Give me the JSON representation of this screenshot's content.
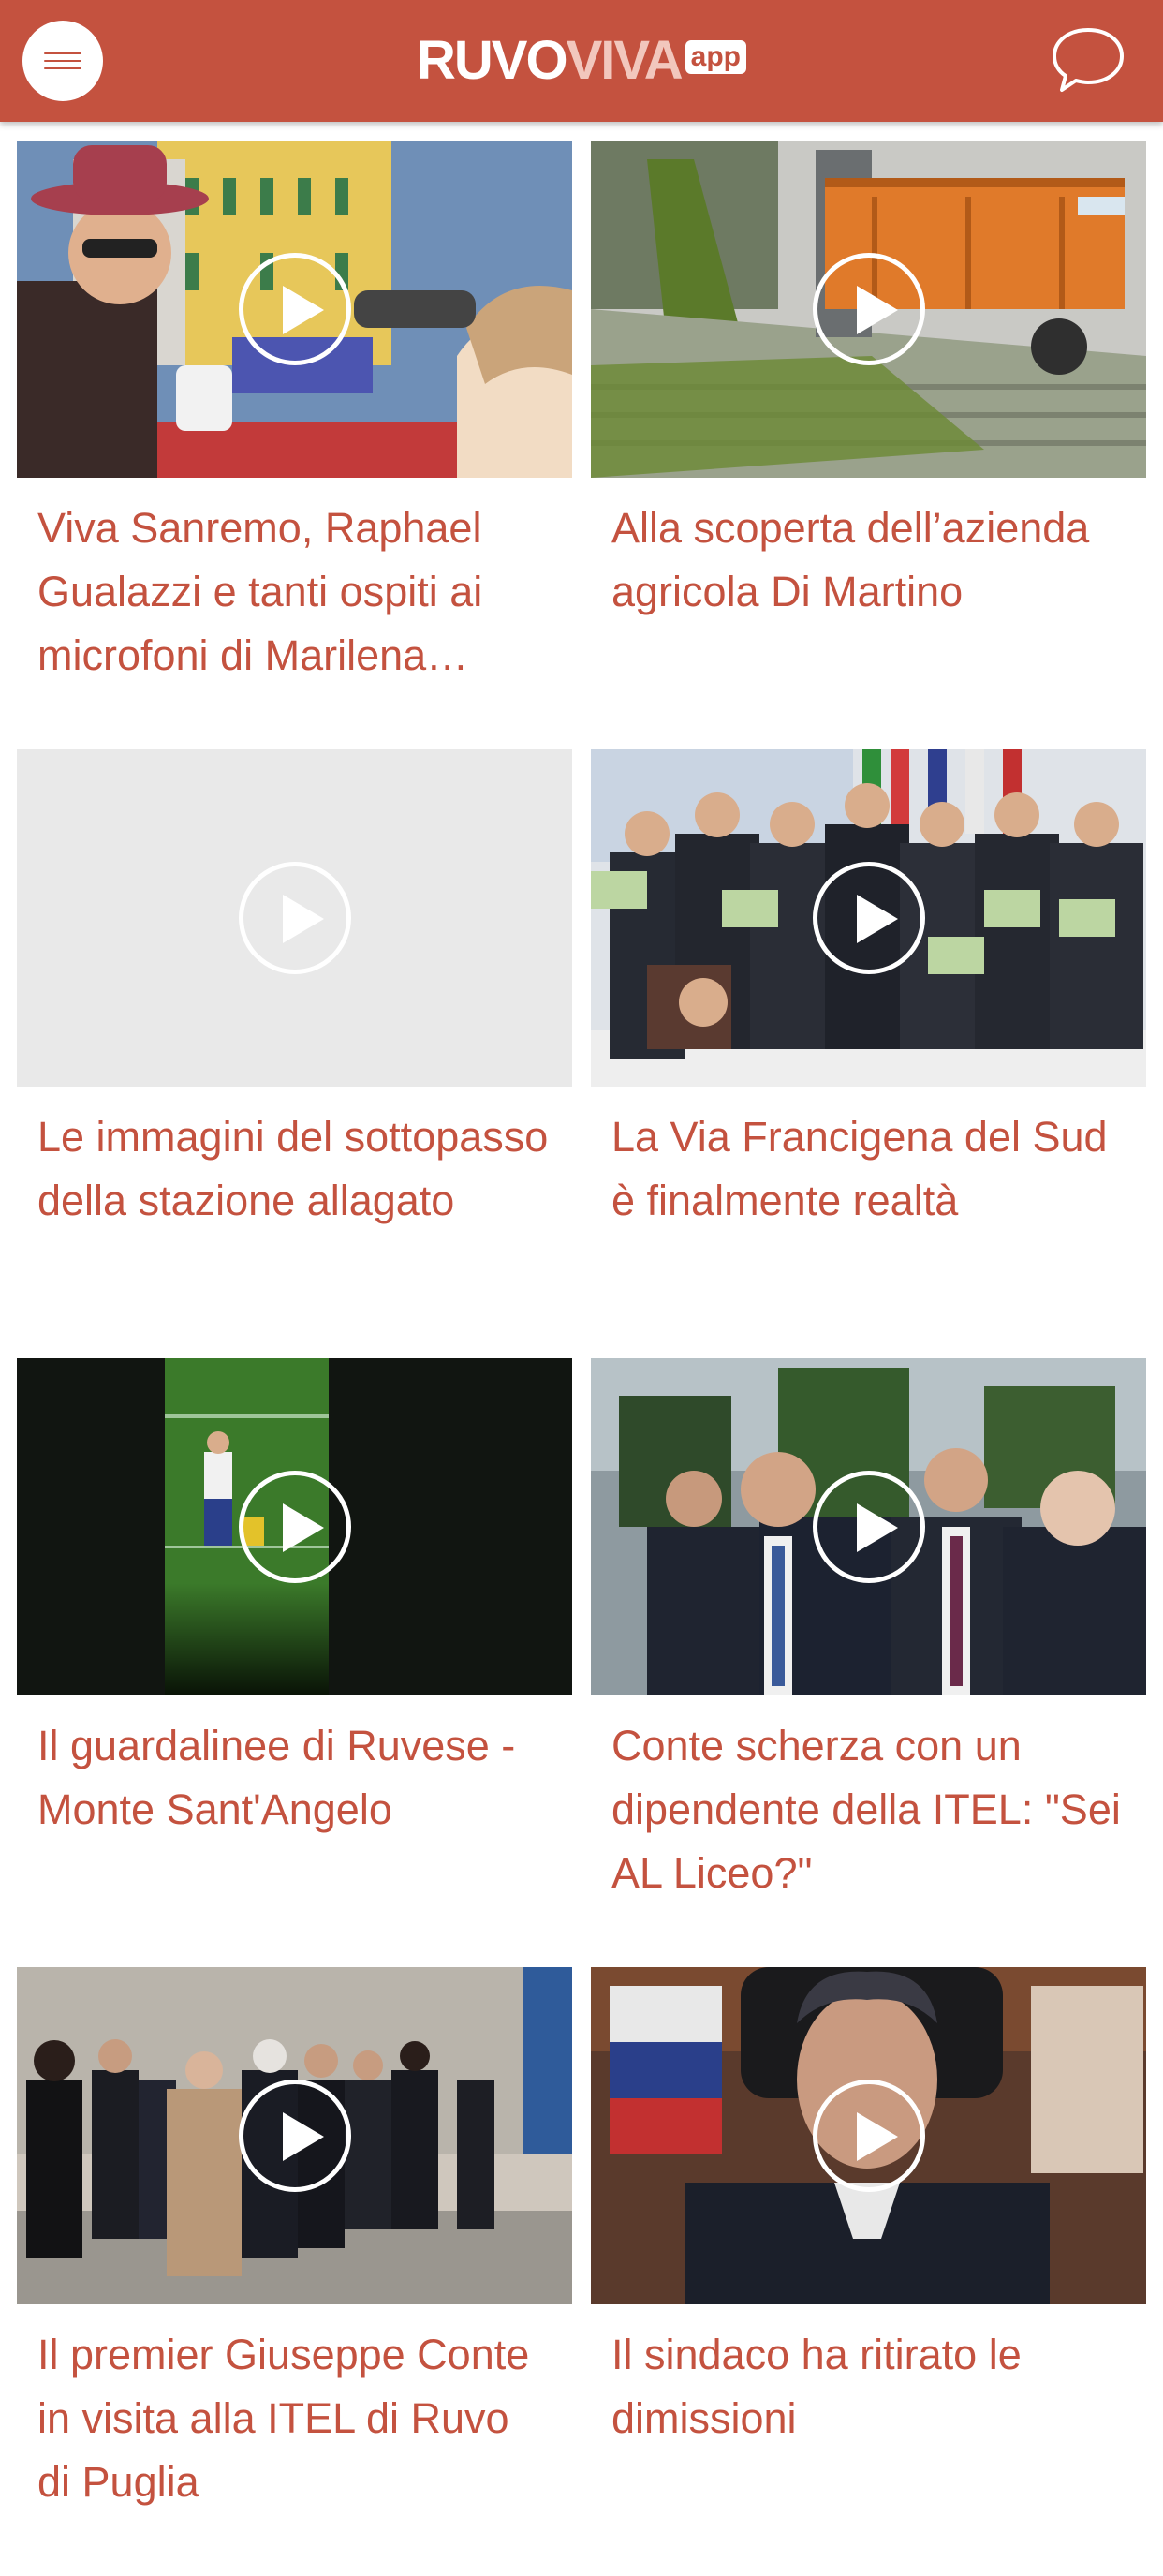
{
  "header": {
    "logo_part1": "RUVO",
    "logo_part2": "VIVA",
    "logo_badge": "app",
    "menu_icon": "hamburger-menu-icon",
    "chat_icon": "chat-bubble-icon",
    "accent_color": "#c4523f"
  },
  "videos": [
    {
      "title": "Viva Sanremo, Raphael Gualazzi e tanti ospiti ai microfoni di Marilena…",
      "thumbnail": "sanremo-interview"
    },
    {
      "title": "Alla scoperta dell’azienda agricola Di Martino",
      "thumbnail": "olive-conveyor"
    },
    {
      "title": "Le immagini del sottopasso della stazione allagato",
      "thumbnail": "empty-placeholder"
    },
    {
      "title": "La Via Francigena del Sud è finalmente realtà",
      "thumbnail": "group-photo-certificates"
    },
    {
      "title": "Il guardalinee di Ruvese - Monte Sant'Angelo",
      "thumbnail": "football-linesman"
    },
    {
      "title": "Conte scherza con un dipendente della ITEL: \"Sei AL Liceo?\"",
      "thumbnail": "conte-crowd"
    },
    {
      "title": "Il premier Giuseppe Conte in visita alla ITEL di Ruvo di Puglia",
      "thumbnail": "conte-visit-walk"
    },
    {
      "title": "Il sindaco ha ritirato le dimissioni",
      "thumbnail": "mayor-portrait"
    }
  ]
}
